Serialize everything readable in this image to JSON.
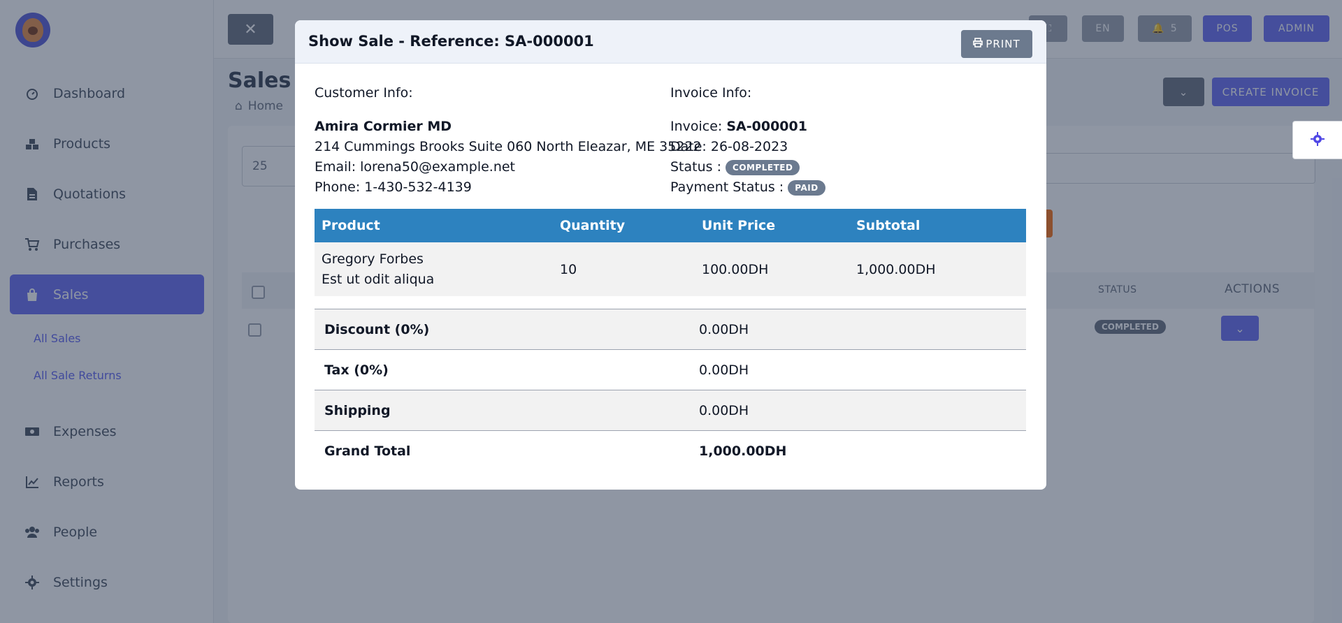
{
  "sidebar": {
    "items": [
      {
        "label": "Dashboard",
        "icon": "gauge-icon"
      },
      {
        "label": "Products",
        "icon": "boxes-icon"
      },
      {
        "label": "Quotations",
        "icon": "file-invoice-icon"
      },
      {
        "label": "Purchases",
        "icon": "cart-icon"
      },
      {
        "label": "Sales",
        "icon": "shopping-bag-icon"
      },
      {
        "label": "Expenses",
        "icon": "money-bill-icon"
      },
      {
        "label": "Reports",
        "icon": "chart-line-icon"
      },
      {
        "label": "People",
        "icon": "users-icon"
      },
      {
        "label": "Settings",
        "icon": "gear-icon"
      }
    ],
    "sales_sub": [
      "All Sales",
      "All Sale Returns"
    ]
  },
  "topbar": {
    "language": "EN",
    "notifications": "5",
    "pos": "POS",
    "user": "ADMIN"
  },
  "page": {
    "title": "Sales",
    "breadcrumb_home": "Home",
    "create_invoice": "CREATE INVOICE",
    "per_page": "25",
    "columns": {
      "status": "STATUS",
      "actions": "ACTIONS"
    },
    "row_status": "COMPLETED"
  },
  "modal": {
    "title_prefix": "Show Sale - Reference: ",
    "reference": "SA-000001",
    "print_label": "PRINT",
    "customer": {
      "heading": "Customer Info:",
      "name": "Amira Cormier MD",
      "address": "214 Cummings Brooks Suite 060 North Eleazar, ME 35222",
      "email": "Email: lorena50@example.net",
      "phone": "Phone: 1-430-532-4139"
    },
    "invoice": {
      "heading": "Invoice Info:",
      "invoice_label": "Invoice: ",
      "invoice_no": "SA-000001",
      "date": "Date: 26-08-2023",
      "status_label": "Status : ",
      "status": "COMPLETED",
      "payment_label": "Payment Status : ",
      "payment_status": "PAID"
    },
    "table": {
      "headers": [
        "Product",
        "Quantity",
        "Unit Price",
        "Subtotal"
      ],
      "rows": [
        {
          "name": "Gregory Forbes",
          "code": "Est ut odit aliqua",
          "quantity": "10",
          "unit_price": "100.00DH",
          "subtotal": "1,000.00DH"
        }
      ]
    },
    "totals": [
      {
        "label": "Discount (0%)",
        "value": "0.00DH"
      },
      {
        "label": "Tax (0%)",
        "value": "0.00DH"
      },
      {
        "label": "Shipping",
        "value": "0.00DH"
      },
      {
        "label": "Grand Total",
        "value": "1,000.00DH"
      }
    ]
  },
  "colors": {
    "accent": "#6a6ff0",
    "table_header": "#2d82bf",
    "badge": "#6b7a8f"
  }
}
